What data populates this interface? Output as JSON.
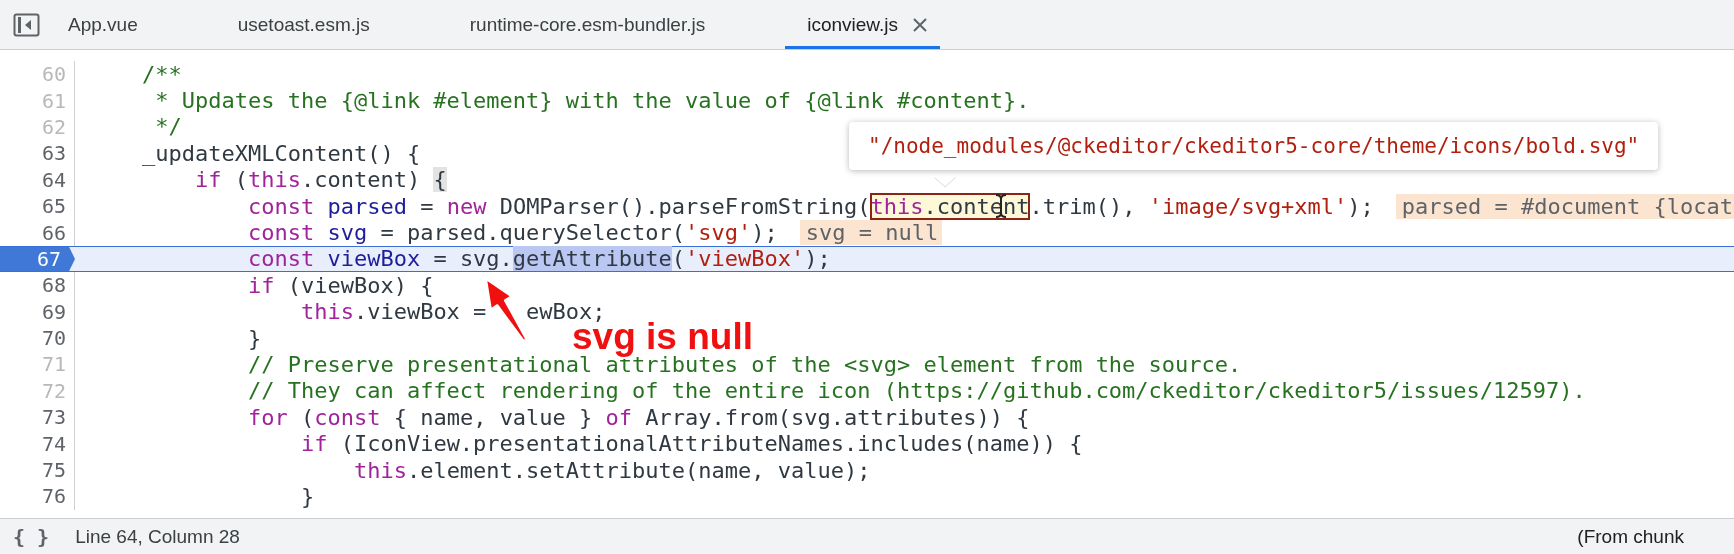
{
  "tabs": [
    {
      "label": "App.vue",
      "selected": false
    },
    {
      "label": "usetoast.esm.js",
      "selected": false
    },
    {
      "label": "runtime-core.esm-bundler.js",
      "selected": false
    },
    {
      "label": "iconview.js",
      "selected": true
    }
  ],
  "lines": [
    {
      "number": "60",
      "breakable": false,
      "current": false,
      "segments": [
        {
          "kind": "code",
          "tokens": [
            {
              "kind": "comment",
              "text": "    /**"
            }
          ]
        }
      ]
    },
    {
      "number": "61",
      "breakable": false,
      "current": false,
      "segments": [
        {
          "kind": "code",
          "tokens": [
            {
              "kind": "comment",
              "text": "     * Updates the {@link #element} with the value of {@link #content}."
            }
          ]
        }
      ]
    },
    {
      "number": "62",
      "breakable": false,
      "current": false,
      "segments": [
        {
          "kind": "code",
          "tokens": [
            {
              "kind": "comment",
              "text": "     */"
            }
          ]
        }
      ]
    },
    {
      "number": "63",
      "breakable": true,
      "current": false,
      "segments": [
        {
          "kind": "code",
          "tokens": [
            {
              "kind": "plain",
              "text": "    _updateXMLContent() {"
            }
          ]
        }
      ]
    },
    {
      "number": "64",
      "breakable": true,
      "current": false,
      "segments": [
        {
          "kind": "code",
          "tokens": [
            {
              "kind": "keyword",
              "text": "        if"
            },
            {
              "kind": "plain",
              "text": " ("
            },
            {
              "kind": "keyword",
              "text": "this"
            },
            {
              "kind": "plain",
              "text": ".content) "
            }
          ]
        },
        {
          "kind": "bracket",
          "tokens": [
            {
              "kind": "plain",
              "text": "{"
            }
          ]
        }
      ]
    },
    {
      "number": "65",
      "breakable": true,
      "current": false,
      "segments": [
        {
          "kind": "code",
          "tokens": [
            {
              "kind": "keyword",
              "text": "            const"
            },
            {
              "kind": "def",
              "text": " parsed"
            },
            {
              "kind": "plain",
              "text": " = "
            },
            {
              "kind": "keyword",
              "text": "new"
            },
            {
              "kind": "plain",
              "text": " DOMParser().parseFromString("
            }
          ]
        },
        {
          "kind": "hover",
          "tokens": [
            {
              "kind": "keyword",
              "text": "this"
            },
            {
              "kind": "plain",
              "text": ".content"
            }
          ]
        },
        {
          "kind": "code",
          "tokens": [
            {
              "kind": "plain",
              "text": ".trim(), "
            },
            {
              "kind": "string",
              "text": "'image/svg+xml'"
            },
            {
              "kind": "plain",
              "text": ");"
            }
          ]
        },
        {
          "kind": "inline_value",
          "tokens": [
            {
              "kind": "plain",
              "text": "parsed = #document {locat"
            }
          ]
        }
      ]
    },
    {
      "number": "66",
      "breakable": true,
      "current": false,
      "segments": [
        {
          "kind": "code",
          "tokens": [
            {
              "kind": "keyword",
              "text": "            const"
            },
            {
              "kind": "def",
              "text": " svg"
            },
            {
              "kind": "plain",
              "text": " = parsed.querySelector("
            },
            {
              "kind": "string",
              "text": "'svg'"
            },
            {
              "kind": "plain",
              "text": ");"
            }
          ]
        },
        {
          "kind": "inline_value",
          "tokens": [
            {
              "kind": "plain",
              "text": "svg = null"
            }
          ]
        }
      ]
    },
    {
      "number": "67",
      "breakable": true,
      "current": true,
      "segments": [
        {
          "kind": "code",
          "tokens": [
            {
              "kind": "keyword",
              "text": "            const"
            },
            {
              "kind": "def",
              "text": " viewBox"
            },
            {
              "kind": "plain",
              "text": " = svg."
            }
          ]
        },
        {
          "kind": "selection",
          "tokens": [
            {
              "kind": "plain",
              "text": "getAttribute"
            }
          ]
        },
        {
          "kind": "code",
          "tokens": [
            {
              "kind": "plain",
              "text": "("
            },
            {
              "kind": "string",
              "text": "'viewBox'"
            },
            {
              "kind": "plain",
              "text": ");"
            }
          ]
        }
      ]
    },
    {
      "number": "68",
      "breakable": true,
      "current": false,
      "segments": [
        {
          "kind": "code",
          "tokens": [
            {
              "kind": "keyword",
              "text": "            if"
            },
            {
              "kind": "plain",
              "text": " (viewBox) {"
            }
          ]
        }
      ]
    },
    {
      "number": "69",
      "breakable": true,
      "current": false,
      "segments": [
        {
          "kind": "code",
          "tokens": [
            {
              "kind": "keyword",
              "text": "                this"
            },
            {
              "kind": "plain",
              "text": ".viewBox ="
            }
          ]
        },
        {
          "kind": "covered_tail",
          "tokens": [
            {
              "kind": "plain",
              "text": "ewBox;"
            }
          ]
        }
      ]
    },
    {
      "number": "70",
      "breakable": true,
      "current": false,
      "segments": [
        {
          "kind": "code",
          "tokens": [
            {
              "kind": "plain",
              "text": "            }"
            }
          ]
        }
      ]
    },
    {
      "number": "71",
      "breakable": false,
      "current": false,
      "segments": [
        {
          "kind": "code",
          "tokens": [
            {
              "kind": "comment",
              "text": "            // Preserve presentational attributes of the <svg> element from the source."
            }
          ]
        }
      ]
    },
    {
      "number": "72",
      "breakable": false,
      "current": false,
      "segments": [
        {
          "kind": "code",
          "tokens": [
            {
              "kind": "comment",
              "text": "            // They can affect rendering of the entire icon (https://github.com/ckeditor/ckeditor5/issues/12597)."
            }
          ]
        }
      ]
    },
    {
      "number": "73",
      "breakable": true,
      "current": false,
      "segments": [
        {
          "kind": "code",
          "tokens": [
            {
              "kind": "keyword",
              "text": "            for"
            },
            {
              "kind": "plain",
              "text": " ("
            },
            {
              "kind": "keyword",
              "text": "const"
            },
            {
              "kind": "plain",
              "text": " { name, value } "
            },
            {
              "kind": "keyword",
              "text": "of"
            },
            {
              "kind": "plain",
              "text": " Array.from(svg.attributes)) {"
            }
          ]
        }
      ]
    },
    {
      "number": "74",
      "breakable": true,
      "current": false,
      "segments": [
        {
          "kind": "code",
          "tokens": [
            {
              "kind": "keyword",
              "text": "                if"
            },
            {
              "kind": "plain",
              "text": " (IconView.presentationalAttributeNames.includes(name)) {"
            }
          ]
        }
      ]
    },
    {
      "number": "75",
      "breakable": true,
      "current": false,
      "segments": [
        {
          "kind": "code",
          "tokens": [
            {
              "kind": "keyword",
              "text": "                    this"
            },
            {
              "kind": "plain",
              "text": ".element.setAttribute(name, value);"
            }
          ]
        }
      ]
    },
    {
      "number": "76",
      "breakable": true,
      "current": false,
      "segments": [
        {
          "kind": "code",
          "tokens": [
            {
              "kind": "plain",
              "text": "                }"
            }
          ]
        }
      ]
    }
  ],
  "tooltip": {
    "text": "\"/node_modules/@ckeditor/ckeditor5-core/theme/icons/bold.svg\""
  },
  "annotation": {
    "text": "svg is null"
  },
  "status_bar": {
    "format_icon": "{ }",
    "position": "Line 64, Column 28",
    "source": "(From chunk"
  }
}
